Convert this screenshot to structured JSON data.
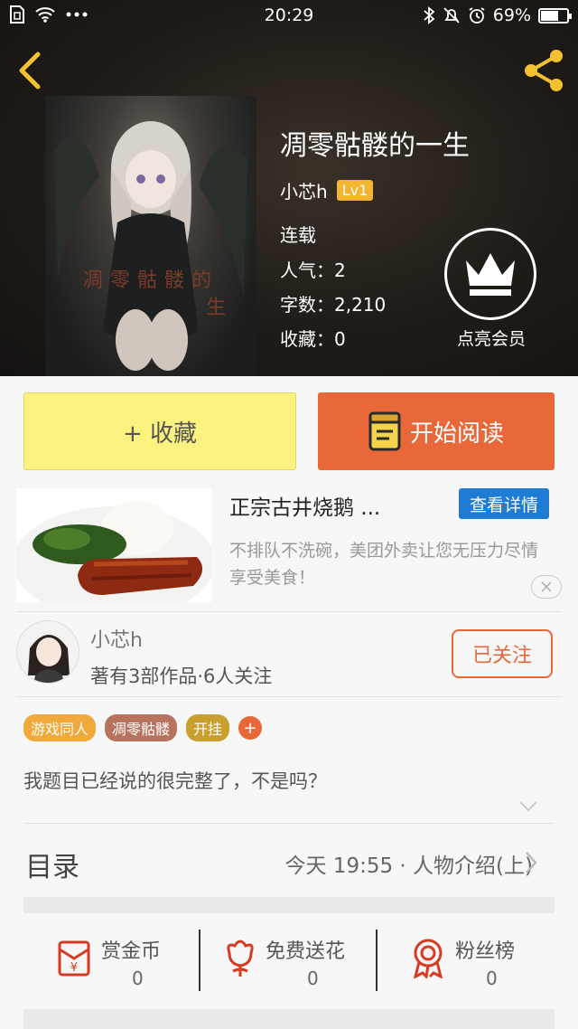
{
  "status_bar": {
    "time": "20:29",
    "battery": "69%",
    "battery_level": 0.69,
    "left_icons": [
      "sim-icon",
      "wifi-icon",
      "more-dots-icon"
    ],
    "right_icons": [
      "bluetooth-icon",
      "mute-bell-icon",
      "alarm-icon",
      "battery-icon"
    ]
  },
  "header": {
    "back_icon": "chevron-left-icon",
    "share_icon": "share-icon",
    "accent": "#f2c230"
  },
  "book": {
    "cover_text_line1": "凋零骷髅的",
    "cover_text_line2": "生",
    "title": "凋零骷髅的一生",
    "author": "小芯h",
    "author_level": "Lv1",
    "status": "连载",
    "popularity": "人气：2",
    "word_count": "字数：2,210",
    "favorites": "收藏：0"
  },
  "vip": {
    "icon": "crown-icon",
    "label": "点亮会员"
  },
  "actions": {
    "favorite_label": "+ 收藏",
    "read_label": "开始阅读",
    "read_icon": "book-icon",
    "favorite_color": "#fbf280",
    "read_color": "#e8683a"
  },
  "ad": {
    "title": "正宗古井烧鹅 ...",
    "detail_button": "查看详情",
    "description": "不排队不洗碗，美团外卖让您无压力尽情享受美食！",
    "close_icon": "close-icon",
    "button_color": "#1f7cd4"
  },
  "author_card": {
    "name": "小芯h",
    "subtitle": "著有3部作品·6人关注",
    "follow_label": "已关注"
  },
  "tags": [
    {
      "label": "游戏同人",
      "color": "#f0a93a"
    },
    {
      "label": "凋零骷髅",
      "color": "#b8735e"
    },
    {
      "label": "开挂",
      "color": "#c9a030"
    }
  ],
  "tag_add_label": "+",
  "description": "我题目已经说的很完整了，不是吗？",
  "toc": {
    "label": "目录",
    "latest": "今天 19:55 · 人物介绍(上)"
  },
  "stats": [
    {
      "label": "赏金币",
      "count": "0",
      "icon": "red-envelope-icon"
    },
    {
      "label": "免费送花",
      "count": "0",
      "icon": "flower-icon"
    },
    {
      "label": "粉丝榜",
      "count": "0",
      "icon": "medal-icon"
    }
  ]
}
